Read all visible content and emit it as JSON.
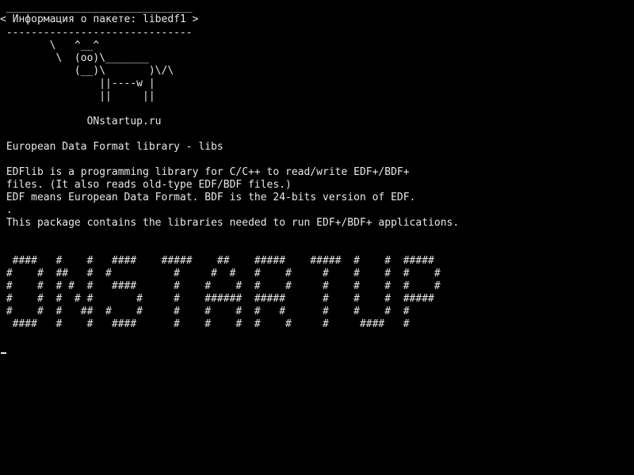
{
  "terminal": {
    "colors": {
      "background": "#000000",
      "foreground": "#e8e8e8"
    },
    "cowsay": {
      "border_top": " ______________________________",
      "message": "< Информация о пакете: libedf1 >",
      "border_bottom": " ------------------------------",
      "cow": [
        "        \\   ^__^",
        "         \\  (oo)\\_______",
        "            (__)\\       )\\/\\",
        "                ||----w |",
        "                ||     ||"
      ]
    },
    "site": "              ONstartup.ru",
    "package_summary": " European Data Format library - libs",
    "description": [
      " EDFlib is a programming library for C/C++ to read/write EDF+/BDF+",
      " files. (It also reads old-type EDF/BDF files.)",
      " EDF means European Data Format. BDF is the 24-bits version of EDF.",
      " .",
      " This package contains the libraries needed to run EDF+/BDF+ applications."
    ],
    "banner": [
      "  ####   #    #   ####    #####    ##    #####    #####  #    #  #####",
      " #    #  ##   #  #          #     #  #   #    #     #    #    #  #    #",
      " #    #  # #  #   ####      #    #    #  #    #     #    #    #  #    #",
      " #    #  #  # #       #     #    ######  #####      #    #    #  #####",
      " #    #  #   ##  #    #     #    #    #  #   #      #    #    #  #",
      "  ####   #    #   ####      #    #    #  #    #     #     ####   #"
    ]
  }
}
